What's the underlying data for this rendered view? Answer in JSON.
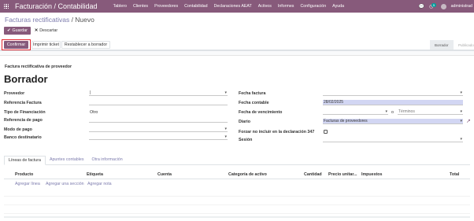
{
  "navbar": {
    "app_title": "Facturación / Contabilidad",
    "menu": [
      "Tablero",
      "Clientes",
      "Proveedores",
      "Contabilidad",
      "Declaraciones AEAT",
      "Activos",
      "Informes",
      "Configuración",
      "Ayuda"
    ],
    "chat_icon": "chat-icon",
    "activity_count": "5",
    "user_name": "administrad",
    "brand_color": "#875a7b"
  },
  "breadcrumb": {
    "parent": "Facturas rectificativas",
    "separator": " / ",
    "current": "Nuevo"
  },
  "actions": {
    "save_label": "Guardar",
    "discard_label": "Descartar"
  },
  "status_bar": {
    "confirm_label": "Confirmar",
    "print_label": "Imprimir ticket",
    "reset_label": "Restablecer a borrador",
    "steps": [
      "Borrador",
      "Publicado"
    ],
    "active_step": "Borrador"
  },
  "form": {
    "doc_type": "Factura rectificativa de proveedor",
    "title": "Borrador",
    "left": {
      "vendor_label": "Proveedor",
      "vendor_value": "|",
      "invoice_ref_label": "Referencia Factura",
      "financing_label": "Tipo de Financiación",
      "financing_value": "Otro",
      "payment_ref_label": "Referencia de pago",
      "payment_mode_label": "Modo de pago",
      "bank_label": "Banco destinatario"
    },
    "right": {
      "invoice_date_label": "Fecha factura",
      "accounting_date_label": "Fecha contable",
      "accounting_date_value": "28/02/2025",
      "due_date_label": "Fecha de vencimiento",
      "due_or_label": "o",
      "due_terms_placeholder": "Términos",
      "journal_label": "Diario",
      "journal_value": "Facturas de proveedores",
      "exclude_347_label": "Forzar no incluir en la declaración 347",
      "session_label": "Sesión"
    }
  },
  "tabs": [
    "Líneas de factura",
    "Apuntes contables",
    "Otra información"
  ],
  "table": {
    "headers": [
      "Producto",
      "Etiqueta",
      "Cuenta",
      "Categoría de activo",
      "Cantidad",
      "Precio unitar...",
      "Impuestos",
      "Total"
    ],
    "add_links": [
      "Agregar línea",
      "Agregar una sección",
      "Agregar nota"
    ]
  }
}
